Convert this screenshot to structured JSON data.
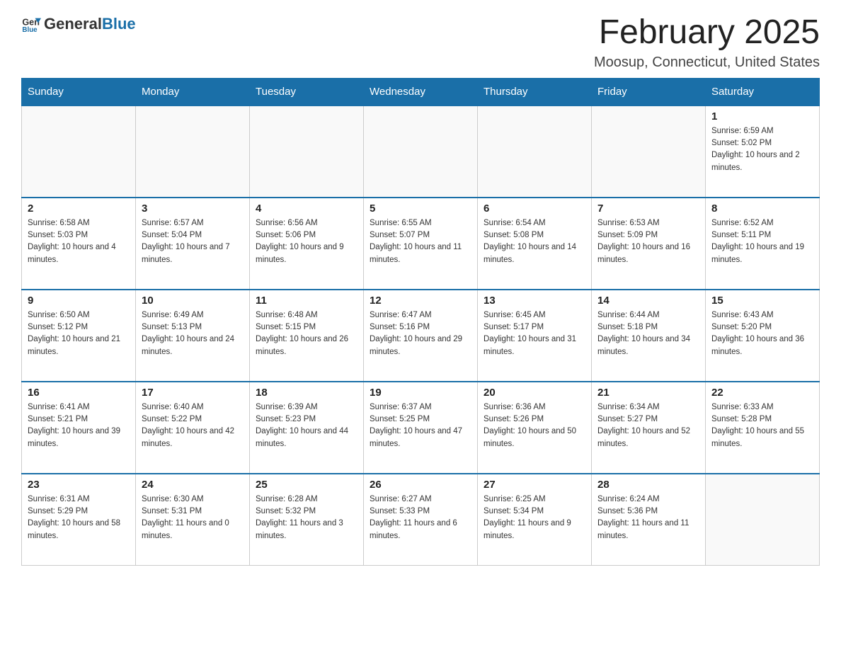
{
  "header": {
    "logo": {
      "general": "General",
      "blue": "Blue"
    },
    "title": "February 2025",
    "location": "Moosup, Connecticut, United States"
  },
  "days_of_week": [
    "Sunday",
    "Monday",
    "Tuesday",
    "Wednesday",
    "Thursday",
    "Friday",
    "Saturday"
  ],
  "weeks": [
    [
      {
        "day": "",
        "info": ""
      },
      {
        "day": "",
        "info": ""
      },
      {
        "day": "",
        "info": ""
      },
      {
        "day": "",
        "info": ""
      },
      {
        "day": "",
        "info": ""
      },
      {
        "day": "",
        "info": ""
      },
      {
        "day": "1",
        "info": "Sunrise: 6:59 AM\nSunset: 5:02 PM\nDaylight: 10 hours and 2 minutes."
      }
    ],
    [
      {
        "day": "2",
        "info": "Sunrise: 6:58 AM\nSunset: 5:03 PM\nDaylight: 10 hours and 4 minutes."
      },
      {
        "day": "3",
        "info": "Sunrise: 6:57 AM\nSunset: 5:04 PM\nDaylight: 10 hours and 7 minutes."
      },
      {
        "day": "4",
        "info": "Sunrise: 6:56 AM\nSunset: 5:06 PM\nDaylight: 10 hours and 9 minutes."
      },
      {
        "day": "5",
        "info": "Sunrise: 6:55 AM\nSunset: 5:07 PM\nDaylight: 10 hours and 11 minutes."
      },
      {
        "day": "6",
        "info": "Sunrise: 6:54 AM\nSunset: 5:08 PM\nDaylight: 10 hours and 14 minutes."
      },
      {
        "day": "7",
        "info": "Sunrise: 6:53 AM\nSunset: 5:09 PM\nDaylight: 10 hours and 16 minutes."
      },
      {
        "day": "8",
        "info": "Sunrise: 6:52 AM\nSunset: 5:11 PM\nDaylight: 10 hours and 19 minutes."
      }
    ],
    [
      {
        "day": "9",
        "info": "Sunrise: 6:50 AM\nSunset: 5:12 PM\nDaylight: 10 hours and 21 minutes."
      },
      {
        "day": "10",
        "info": "Sunrise: 6:49 AM\nSunset: 5:13 PM\nDaylight: 10 hours and 24 minutes."
      },
      {
        "day": "11",
        "info": "Sunrise: 6:48 AM\nSunset: 5:15 PM\nDaylight: 10 hours and 26 minutes."
      },
      {
        "day": "12",
        "info": "Sunrise: 6:47 AM\nSunset: 5:16 PM\nDaylight: 10 hours and 29 minutes."
      },
      {
        "day": "13",
        "info": "Sunrise: 6:45 AM\nSunset: 5:17 PM\nDaylight: 10 hours and 31 minutes."
      },
      {
        "day": "14",
        "info": "Sunrise: 6:44 AM\nSunset: 5:18 PM\nDaylight: 10 hours and 34 minutes."
      },
      {
        "day": "15",
        "info": "Sunrise: 6:43 AM\nSunset: 5:20 PM\nDaylight: 10 hours and 36 minutes."
      }
    ],
    [
      {
        "day": "16",
        "info": "Sunrise: 6:41 AM\nSunset: 5:21 PM\nDaylight: 10 hours and 39 minutes."
      },
      {
        "day": "17",
        "info": "Sunrise: 6:40 AM\nSunset: 5:22 PM\nDaylight: 10 hours and 42 minutes."
      },
      {
        "day": "18",
        "info": "Sunrise: 6:39 AM\nSunset: 5:23 PM\nDaylight: 10 hours and 44 minutes."
      },
      {
        "day": "19",
        "info": "Sunrise: 6:37 AM\nSunset: 5:25 PM\nDaylight: 10 hours and 47 minutes."
      },
      {
        "day": "20",
        "info": "Sunrise: 6:36 AM\nSunset: 5:26 PM\nDaylight: 10 hours and 50 minutes."
      },
      {
        "day": "21",
        "info": "Sunrise: 6:34 AM\nSunset: 5:27 PM\nDaylight: 10 hours and 52 minutes."
      },
      {
        "day": "22",
        "info": "Sunrise: 6:33 AM\nSunset: 5:28 PM\nDaylight: 10 hours and 55 minutes."
      }
    ],
    [
      {
        "day": "23",
        "info": "Sunrise: 6:31 AM\nSunset: 5:29 PM\nDaylight: 10 hours and 58 minutes."
      },
      {
        "day": "24",
        "info": "Sunrise: 6:30 AM\nSunset: 5:31 PM\nDaylight: 11 hours and 0 minutes."
      },
      {
        "day": "25",
        "info": "Sunrise: 6:28 AM\nSunset: 5:32 PM\nDaylight: 11 hours and 3 minutes."
      },
      {
        "day": "26",
        "info": "Sunrise: 6:27 AM\nSunset: 5:33 PM\nDaylight: 11 hours and 6 minutes."
      },
      {
        "day": "27",
        "info": "Sunrise: 6:25 AM\nSunset: 5:34 PM\nDaylight: 11 hours and 9 minutes."
      },
      {
        "day": "28",
        "info": "Sunrise: 6:24 AM\nSunset: 5:36 PM\nDaylight: 11 hours and 11 minutes."
      },
      {
        "day": "",
        "info": ""
      }
    ]
  ]
}
